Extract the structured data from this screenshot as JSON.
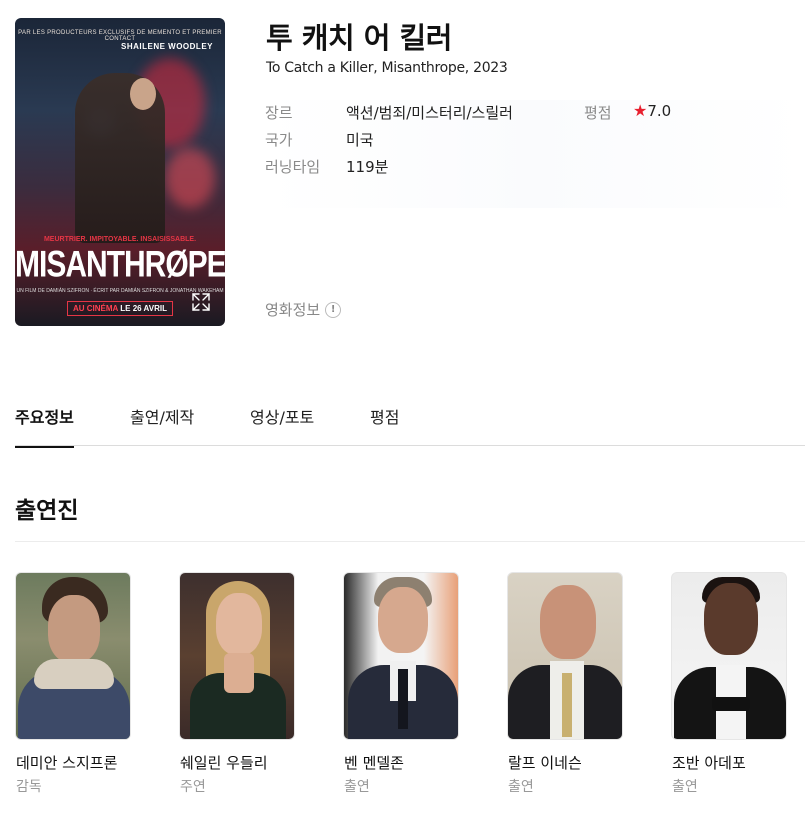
{
  "movie": {
    "title": "투 캐치 어 킬러",
    "subtitle": "To Catch a Killer, Misanthrope, 2023",
    "info": {
      "genre_label": "장르",
      "genre_value": "액션/범죄/미스터리/스릴러",
      "rating_label": "평점",
      "rating_star": "★",
      "rating_value": "7.0",
      "country_label": "국가",
      "country_value": "미국",
      "runtime_label": "러닝타임",
      "runtime_value": "119분"
    },
    "movie_info_link": "영화정보",
    "info_icon": "!"
  },
  "poster": {
    "top_text": "PAR LES PRODUCTEURS EXCLUSIFS DE MEMENTO ET PREMIER CONTACT",
    "actor_name": "SHAILENE WOODLEY",
    "tagline": "MEURTRIER. IMPITOYABLE. INSAISISSABLE.",
    "title": "MISANTHRØPE",
    "credits": "UN FILM DE DAMIÁN SZIFRON · ÉCRIT PAR DAMIÁN SZIFRON & JONATHAN WAKEHAM",
    "release_prefix": "AU CINÉMA",
    "release_date": "LE 26 AVRIL"
  },
  "tabs": [
    "주요정보",
    "출연/제작",
    "영상/포토",
    "평점"
  ],
  "cast_section_title": "출연진",
  "cast": [
    {
      "name": "데미안 스지프론",
      "role": "감독"
    },
    {
      "name": "쉐일린 우들리",
      "role": "주연"
    },
    {
      "name": "벤 멘델존",
      "role": "출연"
    },
    {
      "name": "랄프 이네슨",
      "role": "출연"
    },
    {
      "name": "조반 아데포",
      "role": "출연"
    }
  ],
  "colors": {
    "star": "#e8202f",
    "label": "#8a8a8a",
    "role": "#999999",
    "tab_underline": "#111111"
  },
  "icons": [
    "expand-icon",
    "info-icon",
    "star-icon"
  ]
}
